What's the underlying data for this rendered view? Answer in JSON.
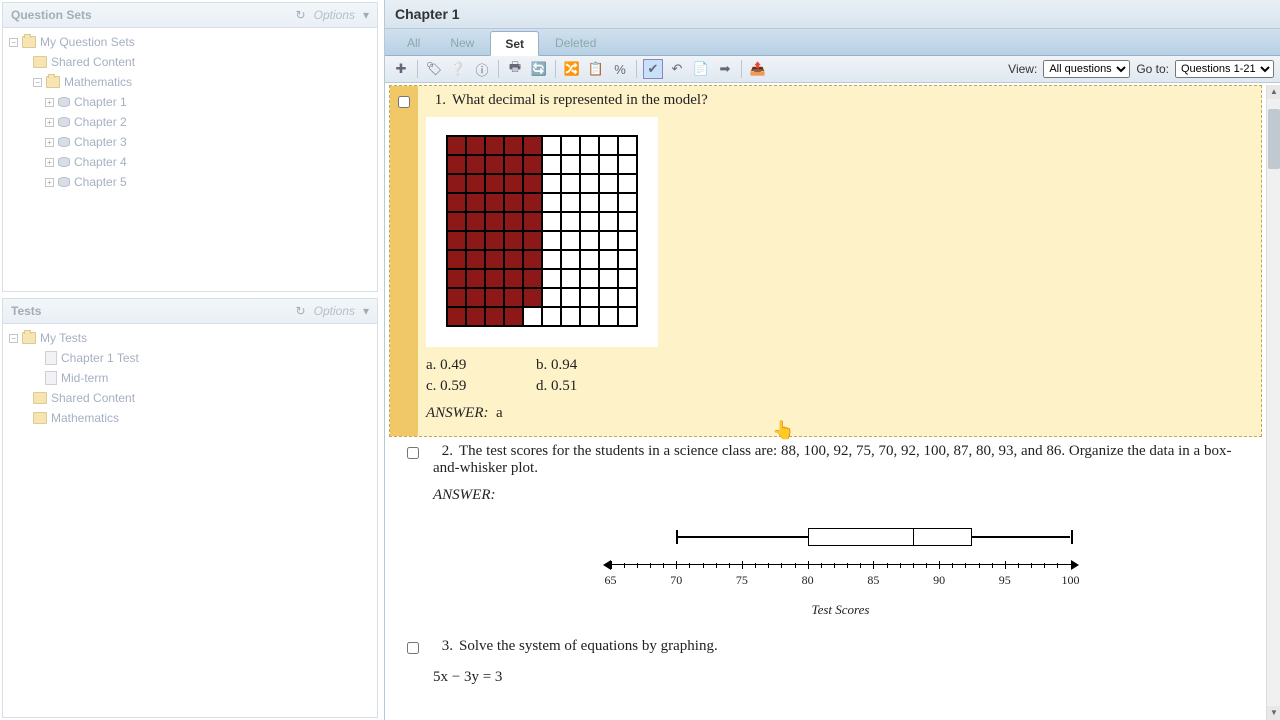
{
  "panels": {
    "question_sets": {
      "title": "Question Sets",
      "options": "Options"
    },
    "tests": {
      "title": "Tests",
      "options": "Options"
    }
  },
  "tree_qs": {
    "my_qs": "My Question Sets",
    "shared": "Shared Content",
    "math": "Mathematics",
    "chapters": [
      "Chapter 1",
      "Chapter 2",
      "Chapter 3",
      "Chapter 4",
      "Chapter 5"
    ]
  },
  "tree_tests": {
    "my_tests": "My Tests",
    "items": [
      "Chapter 1 Test",
      "Mid-term"
    ],
    "shared": "Shared Content",
    "math": "Mathematics"
  },
  "main": {
    "title": "Chapter 1",
    "tabs": {
      "all": "All",
      "new": "New",
      "set": "Set",
      "deleted": "Deleted"
    },
    "view_label": "View:",
    "view_options": [
      "All questions"
    ],
    "goto_label": "Go to:",
    "goto_options": [
      "Questions 1-21"
    ]
  },
  "questions": [
    {
      "num": "1.",
      "text": "What decimal is represented in the model?",
      "choices": {
        "a": "a.  0.49",
        "b": "b.  0.94",
        "c": "c.  0.59",
        "d": "d.  0.51"
      },
      "answer_label": "ANSWER:",
      "answer": "a"
    },
    {
      "num": "2.",
      "text": "The test scores for the students in a science class are: 88, 100, 92, 75, 70, 92, 100, 87, 80, 93, and 86. Organize the data in a box-and-whisker plot.",
      "answer_label": "ANSWER:",
      "axis_label": "Test Scores"
    },
    {
      "num": "3.",
      "text": "Solve the system of equations by graphing.",
      "eq": "5x − 3y = 3"
    }
  ],
  "chart_data": [
    {
      "type": "heatmap",
      "description": "10x10 hundredths grid; 49 cells shaded (value 0.49)",
      "rows": 10,
      "cols": 10,
      "shaded": 49
    },
    {
      "type": "boxplot",
      "title": "Test Scores",
      "axis": {
        "min": 65,
        "max": 100,
        "step": 5
      },
      "min": 70,
      "q1": 80,
      "median": 88,
      "q3": 92.5,
      "max": 100
    }
  ],
  "axis_ticks": [
    "65",
    "70",
    "75",
    "80",
    "85",
    "90",
    "95",
    "100"
  ]
}
